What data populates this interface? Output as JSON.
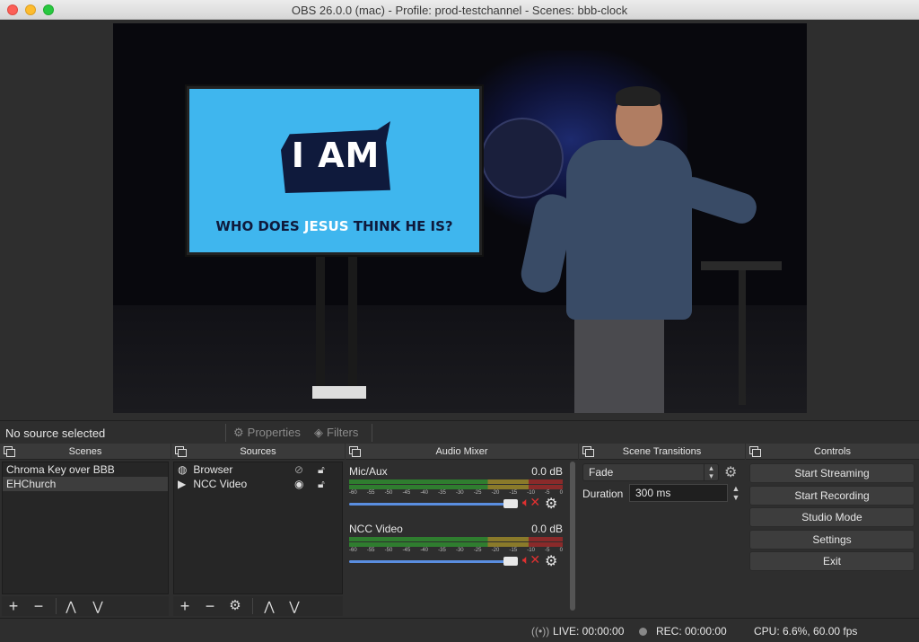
{
  "window": {
    "title": "OBS 26.0.0 (mac) - Profile: prod-testchannel - Scenes: bbb-clock"
  },
  "preview": {
    "slide_big_text": "I AM",
    "slide_line_pre": "WHO DOES ",
    "slide_line_highlight": "JESUS",
    "slide_line_post": " THINK HE IS?"
  },
  "source_bar": {
    "selection_label": "No source selected",
    "properties_label": "Properties",
    "filters_label": "Filters"
  },
  "scenes": {
    "title": "Scenes",
    "items": [
      {
        "label": "Chroma Key over BBB"
      },
      {
        "label": "EHChurch"
      }
    ]
  },
  "sources": {
    "title": "Sources",
    "items": [
      {
        "label": "Browser",
        "icon": "globe-icon"
      },
      {
        "label": "NCC Video",
        "icon": "play-icon"
      }
    ]
  },
  "audio_mixer": {
    "title": "Audio Mixer",
    "channels": [
      {
        "name": "Mic/Aux",
        "db": "0.0 dB"
      },
      {
        "name": "NCC Video",
        "db": "0.0 dB"
      }
    ],
    "scale": [
      "-60",
      "-55",
      "-50",
      "-45",
      "-40",
      "-35",
      "-30",
      "-25",
      "-20",
      "-15",
      "-10",
      "-5",
      "0"
    ]
  },
  "transitions": {
    "title": "Scene Transitions",
    "selected": "Fade",
    "duration_label": "Duration",
    "duration_value": "300 ms"
  },
  "controls": {
    "title": "Controls",
    "start_streaming": "Start Streaming",
    "start_recording": "Start Recording",
    "studio_mode": "Studio Mode",
    "settings": "Settings",
    "exit": "Exit"
  },
  "status": {
    "live": "LIVE: 00:00:00",
    "rec": "REC: 00:00:00",
    "cpu": "CPU: 6.6%, 60.00 fps"
  },
  "colors": {
    "accent_volume": "#5a8ee0",
    "mute_red": "#e03030",
    "slide_blue": "#3fb6ee",
    "slide_navy": "#0f1a3c"
  }
}
